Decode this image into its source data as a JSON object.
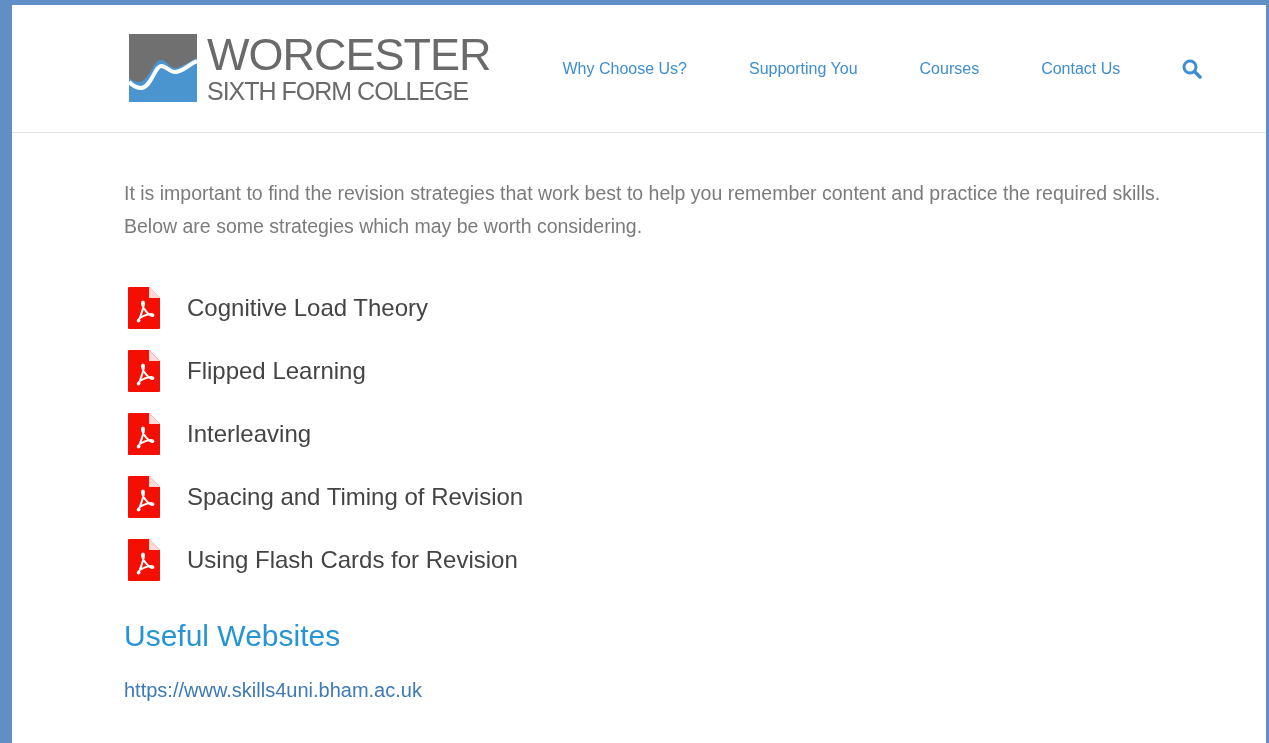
{
  "logo": {
    "line_1": "WORCESTER",
    "line_2": "SIXTH FORM COLLEGE"
  },
  "nav": [
    {
      "label": "Why Choose Us?"
    },
    {
      "label": "Supporting You"
    },
    {
      "label": "Courses"
    },
    {
      "label": "Contact Us"
    }
  ],
  "intro": "It is important to find the revision strategies that work best to help you remember content and practice the required skills. Below are some strategies which may be worth considering.",
  "documents": [
    {
      "title": "Cognitive Load Theory"
    },
    {
      "title": "Flipped Learning"
    },
    {
      "title": "Interleaving"
    },
    {
      "title": "Spacing and Timing of Revision"
    },
    {
      "title": "Using Flash Cards for Revision"
    }
  ],
  "useful_websites": {
    "heading": "Useful Websites",
    "links": [
      "https://www.skills4uni.bham.ac.uk"
    ]
  }
}
